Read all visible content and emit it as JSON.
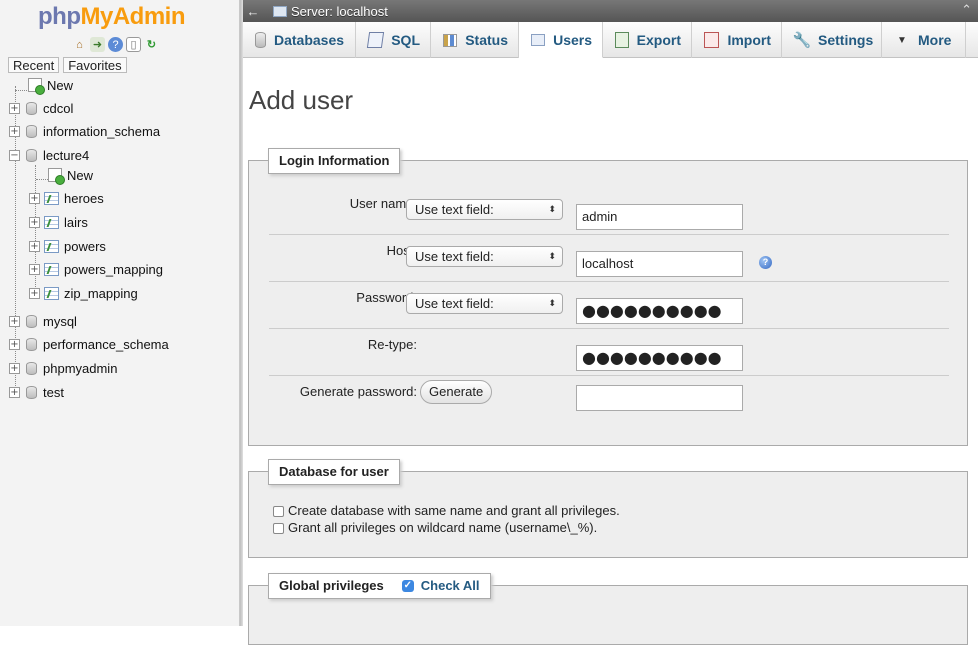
{
  "app": {
    "logo_php": "php",
    "logo_my": "My",
    "logo_admin": "Admin"
  },
  "nav": {
    "recent_label": "Recent",
    "favorites_label": "Favorites",
    "tree": {
      "new": "New",
      "cdcol": "cdcol",
      "information_schema": "information_schema",
      "lecture4": "lecture4",
      "lecture4_new": "New",
      "heroes": "heroes",
      "lairs": "lairs",
      "powers": "powers",
      "powers_mapping": "powers_mapping",
      "zip_mapping": "zip_mapping",
      "mysql": "mysql",
      "performance_schema": "performance_schema",
      "phpmyadmin": "phpmyadmin",
      "test": "test"
    },
    "expander_plus": "+",
    "expander_minus": "−"
  },
  "topbar": {
    "back_glyph": "←",
    "title": "Server: localhost",
    "collapse_glyph": "⌃"
  },
  "tabs": {
    "databases": "Databases",
    "sql": "SQL",
    "status": "Status",
    "users": "Users",
    "export": "Export",
    "import": "Import",
    "settings": "Settings",
    "more": "More",
    "active": "users"
  },
  "page": {
    "title": "Add user"
  },
  "login": {
    "legend": "Login Information",
    "user_label": "User name:",
    "user_mode": "Use text field:",
    "user_value": "admin",
    "host_label": "Host:",
    "host_mode": "Use text field:",
    "host_value": "localhost",
    "password_label": "Password:",
    "password_mode": "Use text field:",
    "password_value": "●●●●●●●●●●",
    "retype_label": "Re-type:",
    "retype_value": "●●●●●●●●●●",
    "generate_label": "Generate password:",
    "generate_button": "Generate",
    "generate_value": ""
  },
  "database_for_user": {
    "legend": "Database for user",
    "option1": "Create database with same name and grant all privileges.",
    "option2": "Grant all privileges on wildcard name (username\\_%)."
  },
  "global_privileges": {
    "legend": "Global privileges",
    "check_all": "Check All",
    "check_all_checked": true
  },
  "colors": {
    "tab_text": "#235a81",
    "logo_php": "#6c78af",
    "logo_myadmin": "#f89c0e",
    "topbar_bg": "#666666",
    "fieldset_bg": "#eeeeee"
  },
  "icons": {
    "home": "home-icon",
    "logout": "logout-icon",
    "help": "help-icon",
    "docs": "docs-icon",
    "reload": "reload-icon"
  }
}
